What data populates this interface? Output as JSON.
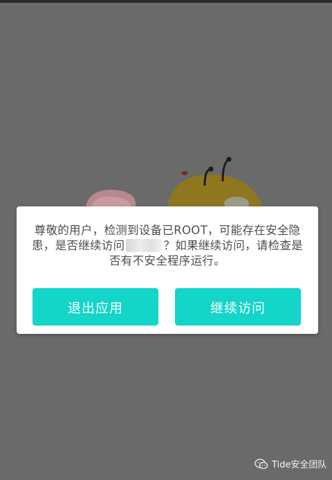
{
  "dialog": {
    "message_part1": "尊敬的用户，检测到设备已ROOT，可能存在安全隐患，是否继续访问",
    "message_part2": "？如果继续访问，请检查是否有不安全程序运行。",
    "exit_button_label": "退出应用",
    "continue_button_label": "继续访问"
  },
  "watermark": {
    "text": "Tide安全团队"
  },
  "colors": {
    "overlay": "#6a6a6a",
    "button": "#13d5c8",
    "button_text": "#ffffff",
    "message_text": "#4d4d4d"
  },
  "icons": {
    "watermark_icon": "wechat-icon"
  }
}
